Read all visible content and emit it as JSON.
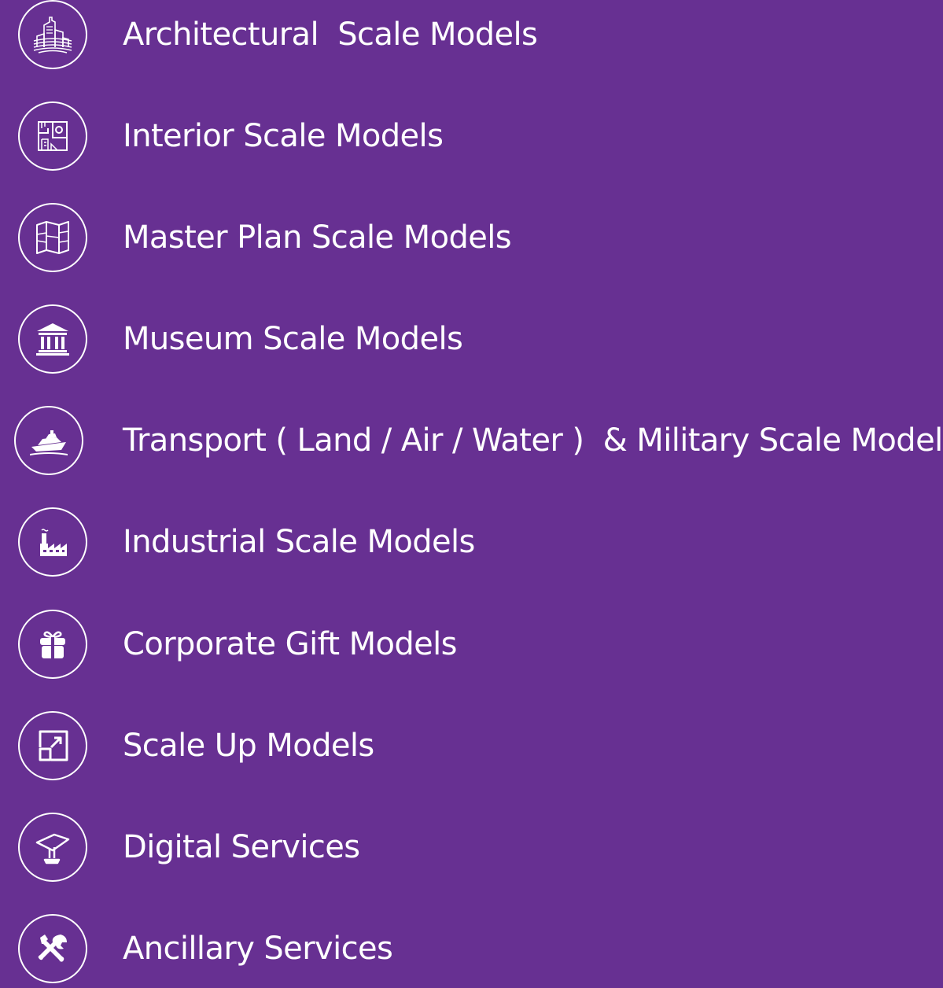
{
  "colors": {
    "background": "#673092",
    "foreground": "#ffffff"
  },
  "services": [
    {
      "label": "Architectural  Scale Models",
      "icon": "skyscraper-icon"
    },
    {
      "label": "Interior Scale Models",
      "icon": "floor-plan-icon"
    },
    {
      "label": "Master Plan Scale Models",
      "icon": "folded-map-icon"
    },
    {
      "label": "Museum Scale Models",
      "icon": "museum-building-icon"
    },
    {
      "label": "Transport ( Land / Air / Water )  & Military Scale Models",
      "icon": "ship-icon"
    },
    {
      "label": "Industrial Scale Models",
      "icon": "factory-icon"
    },
    {
      "label": "Corporate Gift Models",
      "icon": "gift-icon"
    },
    {
      "label": "Scale Up Models",
      "icon": "scale-up-arrow-icon"
    },
    {
      "label": "Digital Services",
      "icon": "digital-kiosk-icon"
    },
    {
      "label": "Ancillary Services",
      "icon": "tools-icon"
    }
  ]
}
